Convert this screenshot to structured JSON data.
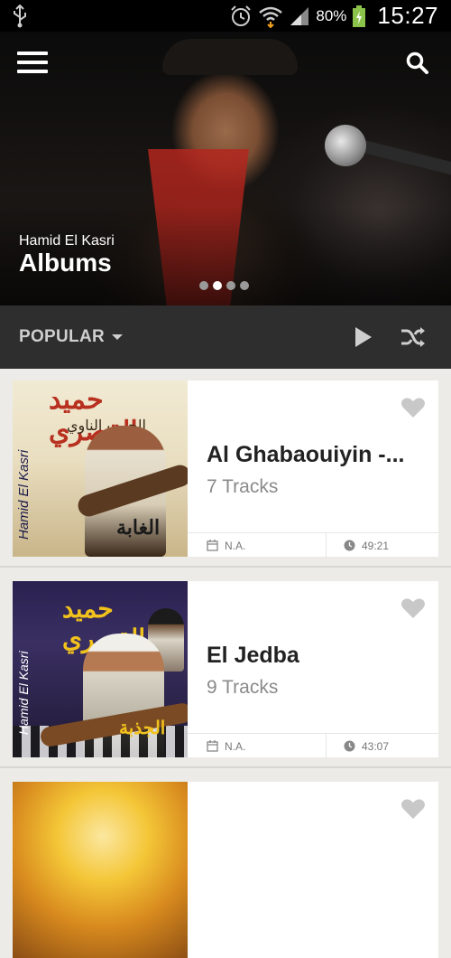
{
  "status_bar": {
    "battery": "80%",
    "time": "15:27"
  },
  "hero": {
    "artist": "Hamid El Kasri",
    "title": "Albums",
    "carousel_dots": 4,
    "carousel_active": 1
  },
  "filter_bar": {
    "sort_label": "POPULAR"
  },
  "albums": [
    {
      "cover_text_arabic_main": "حميد القصري",
      "cover_text_arabic_sub": "الحرب الناوي",
      "cover_text_vertical": "Hamid El Kasri",
      "cover_text_arabic_bottom": "الغابة",
      "title": "Al Ghabaouiyin -...",
      "tracks": "7 Tracks",
      "date": "N.A.",
      "duration": "49:21"
    },
    {
      "cover_text_arabic_main": "حميد القصري",
      "cover_text_vertical": "Hamid El Kasri",
      "cover_text_arabic_bottom": "الجذبة",
      "title": "El Jedba",
      "tracks": "9 Tracks",
      "date": "N.A.",
      "duration": "43:07"
    }
  ],
  "colors": {
    "page_bg": "#ecebe8",
    "filter_bar_bg": "#2e2e2e",
    "card_bg": "#ffffff",
    "heart_color": "#c8c8c8"
  }
}
